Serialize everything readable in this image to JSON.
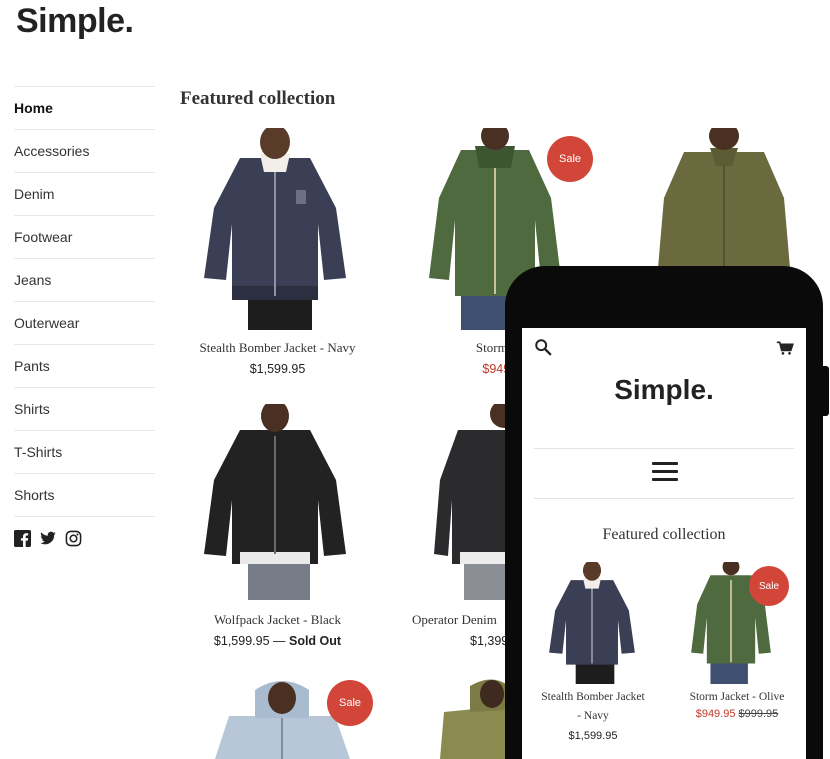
{
  "store": {
    "logo": "Simple."
  },
  "sidebar": {
    "items": [
      {
        "label": "Home",
        "active": true
      },
      {
        "label": "Accessories"
      },
      {
        "label": "Denim"
      },
      {
        "label": "Footwear"
      },
      {
        "label": "Jeans"
      },
      {
        "label": "Outerwear"
      },
      {
        "label": "Pants"
      },
      {
        "label": "Shirts"
      },
      {
        "label": "T-Shirts"
      },
      {
        "label": "Shorts"
      }
    ],
    "social_icons": [
      "facebook-icon",
      "twitter-icon",
      "instagram-icon"
    ]
  },
  "featured": {
    "title": "Featured collection",
    "sale_badge": "Sale",
    "products": [
      {
        "name": "Stealth Bomber Jacket - Navy",
        "price": "$1,599.95"
      },
      {
        "name": "Storm Jack",
        "sale_price": "$949.95"
      },
      {
        "name": ""
      },
      {
        "name": "Wolfpack Jacket - Black",
        "price": "$1,599.95",
        "separator": " — ",
        "status": "Sold Out"
      },
      {
        "name": "Operator Denim",
        "price": "$1,399"
      }
    ]
  },
  "mobile": {
    "logo": "Simple.",
    "title": "Featured collection",
    "sale_badge": "Sale",
    "products": [
      {
        "name_line1": "Stealth Bomber Jacket",
        "name_line2": "- Navy",
        "price": "$1,599.95"
      },
      {
        "name": "Storm Jacket - Olive",
        "sale_price": "$949.95",
        "compare_price": "$999.95"
      }
    ]
  },
  "colors": {
    "sale": "#d2463a",
    "sale_price": "#c0392b",
    "navy_jacket": "#3b3f55",
    "olive_jacket": "#4f6a3e",
    "black_jacket": "#222222",
    "shirt_olive": "#6b6a3e",
    "denim_light": "#b7c7d8"
  }
}
